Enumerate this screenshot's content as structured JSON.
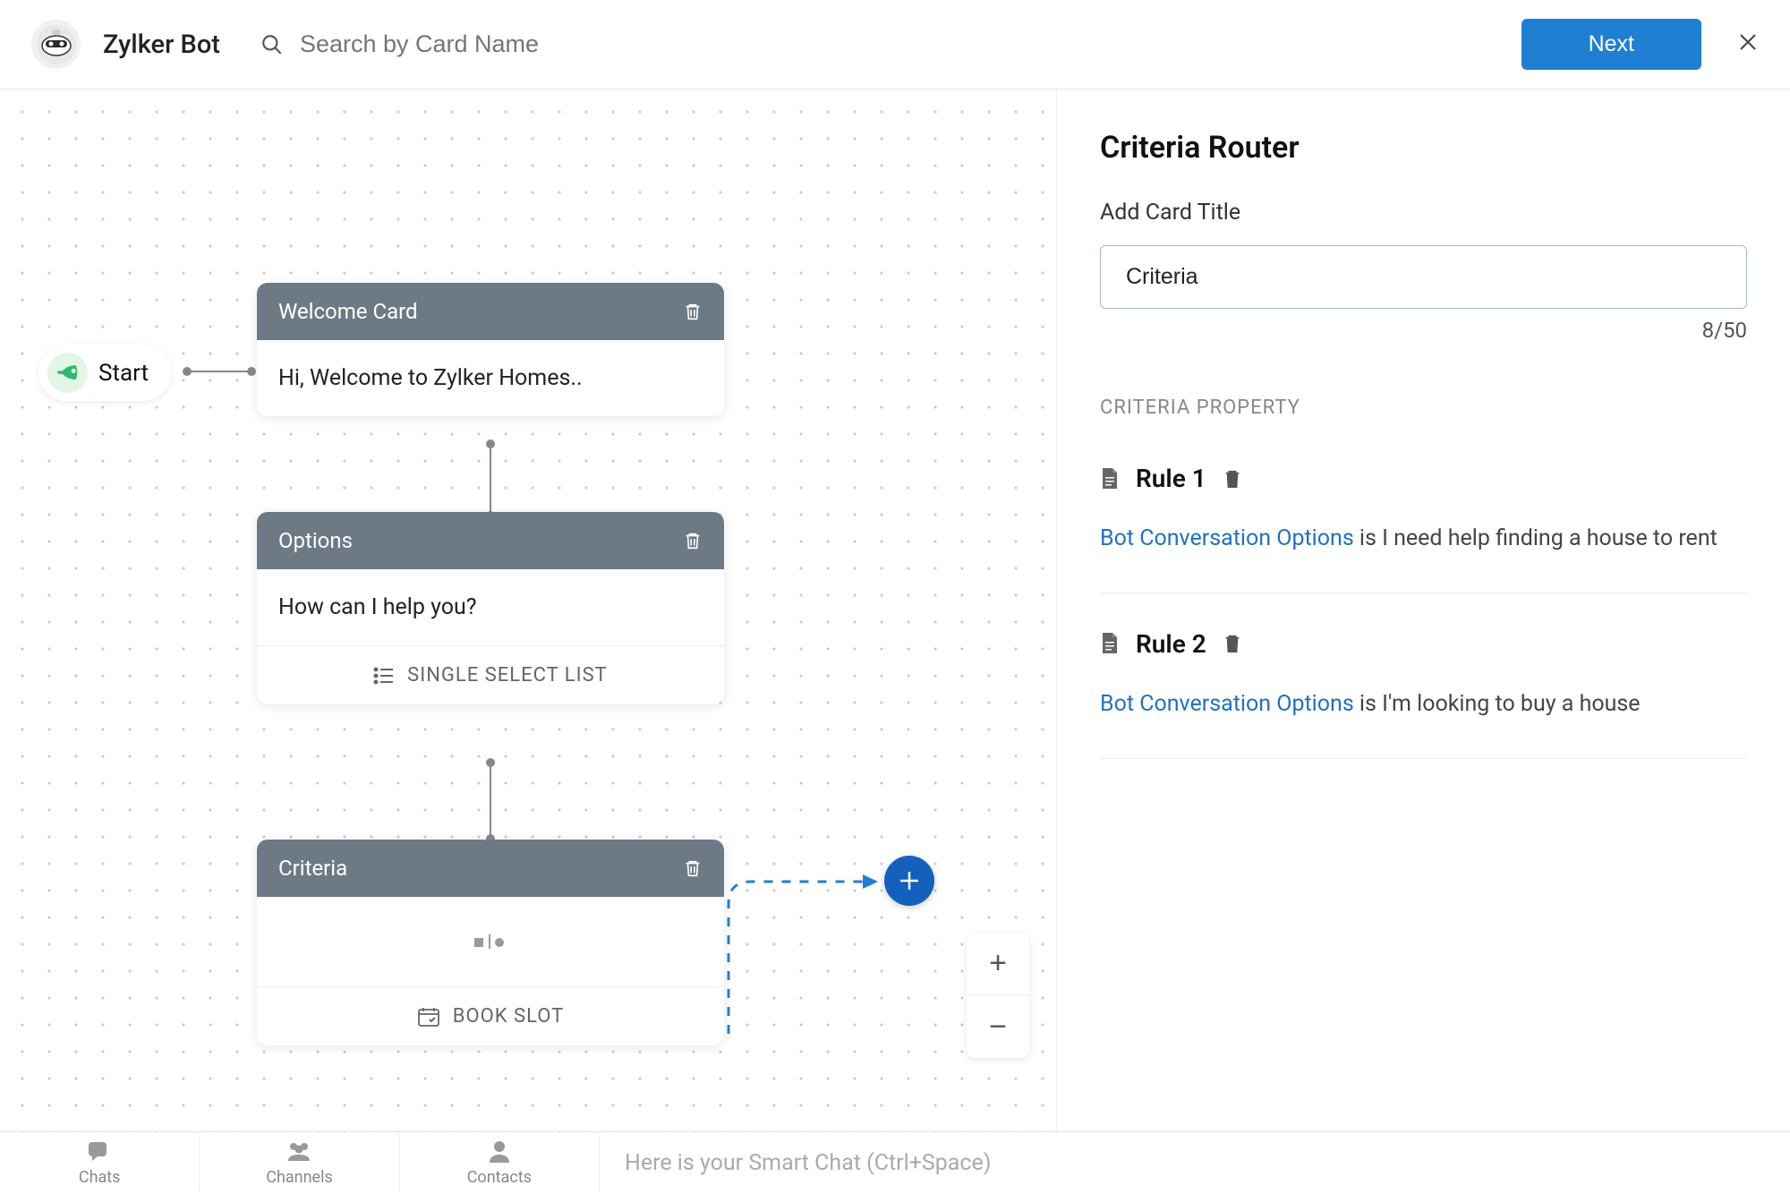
{
  "header": {
    "bot_name": "Zylker Bot",
    "search_placeholder": "Search by Card Name",
    "next_label": "Next"
  },
  "canvas": {
    "start_label": "Start",
    "cards": {
      "welcome": {
        "title": "Welcome Card",
        "body": "Hi, Welcome to Zylker Homes.."
      },
      "options": {
        "title": "Options",
        "body": "How can I help you?",
        "footer": "SINGLE SELECT LIST"
      },
      "criteria": {
        "title": "Criteria",
        "footer": "BOOK SLOT"
      }
    }
  },
  "panel": {
    "title": "Criteria Router",
    "field_label": "Add Card Title",
    "title_value": "Criteria",
    "char_count": "8/50",
    "section_label": "CRITERIA PROPERTY",
    "rules": [
      {
        "name": "Rule 1",
        "link": "Bot Conversation Options",
        "text": " is I need help finding a house to rent"
      },
      {
        "name": "Rule 2",
        "link": "Bot Conversation Options",
        "text": " is I'm looking to buy a house"
      }
    ]
  },
  "bottom": {
    "tabs": [
      "Chats",
      "Channels",
      "Contacts"
    ],
    "smart_chat": "Here is your Smart Chat (Ctrl+Space)"
  }
}
